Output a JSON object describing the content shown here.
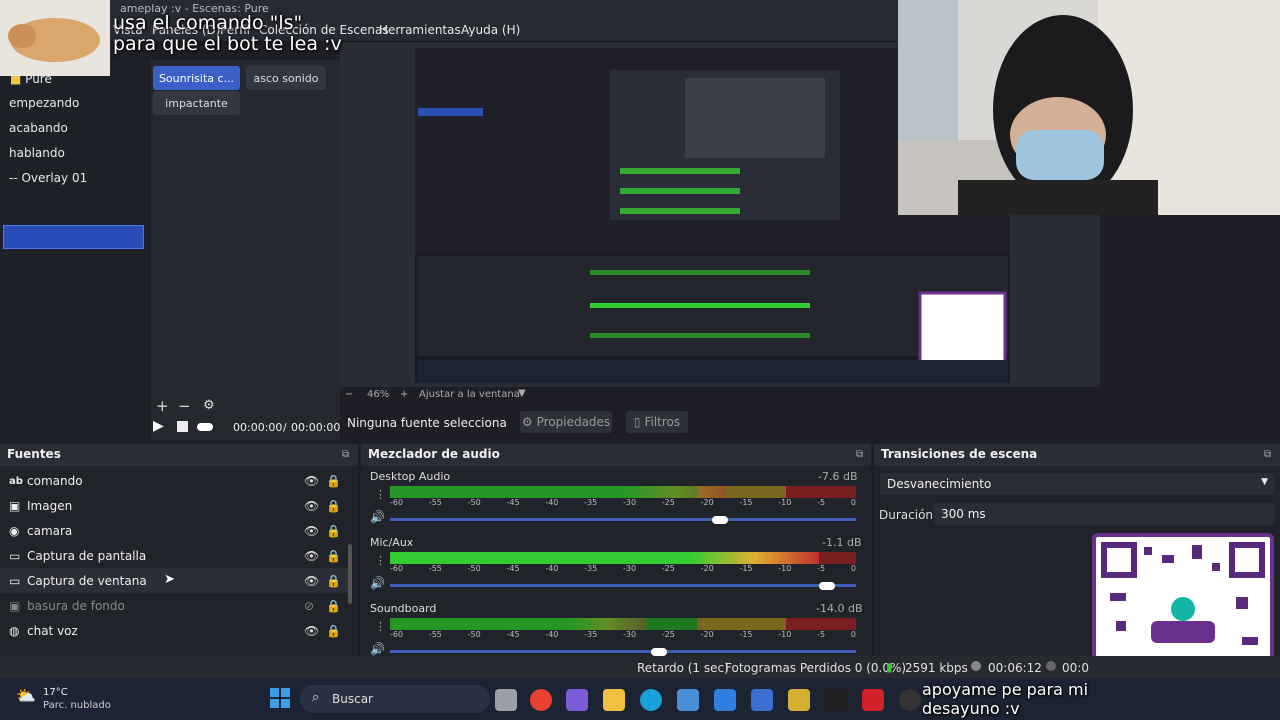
{
  "window": {
    "title": "ameplay :v - Escenas: Pure"
  },
  "menu": {
    "items": [
      "Vista",
      "Paneles (D)",
      "Perfil",
      "Colección de Escenas",
      "Herramientas",
      "Ayuda (H)"
    ]
  },
  "overlay": {
    "chat_message": "usa el comando \"ls\"\npara que el bot te lea :v",
    "donation_message": "apoyame pe para mi\ndesayuno :v"
  },
  "scenes": {
    "items": [
      "Pure",
      "empezando",
      "acabando",
      "hablando",
      "-- Overlay 01"
    ],
    "selected": "-- Overlay 01"
  },
  "scene_buttons": {
    "items": [
      "Sounrisita c...",
      "asco sonido",
      "impactante"
    ]
  },
  "preview_controls": {
    "zoom": "46%",
    "fit_label": "Ajustar a la ventana"
  },
  "playback": {
    "current": "00:00:00",
    "separator": "/",
    "total": "00:00:00"
  },
  "source_toolbar": {
    "no_source": "Ninguna fuente selecciona",
    "properties": "Propiedades",
    "filters": "Filtros"
  },
  "sources": {
    "title": "Fuentes",
    "items": [
      {
        "name": "comando",
        "icon": "text-icon",
        "visible": true
      },
      {
        "name": "Imagen",
        "icon": "image-icon",
        "visible": true
      },
      {
        "name": "camara",
        "icon": "camera-icon",
        "visible": true
      },
      {
        "name": "Captura de pantalla",
        "icon": "monitor-icon",
        "visible": true
      },
      {
        "name": "Captura de ventana",
        "icon": "window-icon",
        "visible": true
      },
      {
        "name": "basura de fondo",
        "icon": "image-icon",
        "visible": false
      },
      {
        "name": "chat voz",
        "icon": "globe-icon",
        "visible": true
      }
    ]
  },
  "mixer": {
    "title": "Mezclador de audio",
    "channels": [
      {
        "name": "Desktop Audio",
        "db": "-7.6 dB",
        "level": 0.72
      },
      {
        "name": "Mic/Aux",
        "db": "-1.1 dB",
        "level": 0.92
      },
      {
        "name": "Soundboard",
        "db": "-14.0 dB",
        "level": 0.55
      }
    ],
    "ticks": [
      "-60",
      "-55",
      "-50",
      "-45",
      "-40",
      "-35",
      "-30",
      "-25",
      "-20",
      "-15",
      "-10",
      "-5",
      "0"
    ]
  },
  "transitions": {
    "title": "Transiciones de escena",
    "selected": "Desvanecimiento",
    "duration_label": "Duración",
    "duration_value": "300 ms"
  },
  "status": {
    "delay": "Retardo (1 sec)",
    "dropped": "Fotogramas Perdidos 0 (0.0%)",
    "bitrate": "2591 kbps",
    "live_time": "00:06:12",
    "rec_time": "00:0"
  },
  "taskbar": {
    "weather_temp": "17°C",
    "weather_desc": "Parc. nublado",
    "search": "Buscar"
  },
  "colors": {
    "accent": "#284cb8",
    "meter_green": "#33cc33",
    "meter_yellow": "#e0b030",
    "meter_red": "#c03030"
  }
}
